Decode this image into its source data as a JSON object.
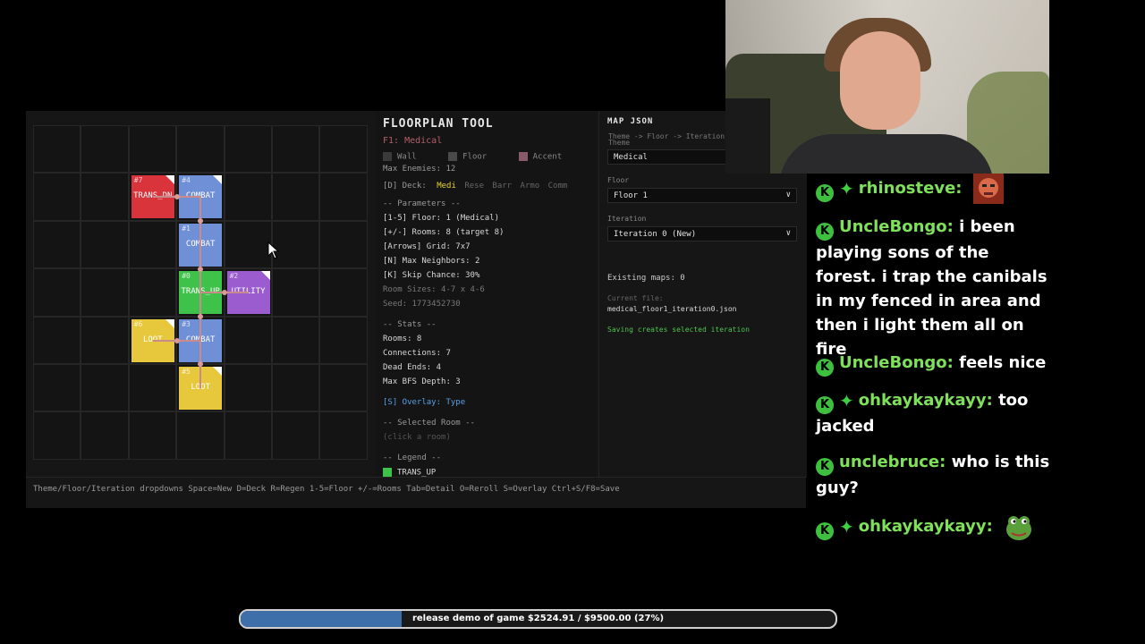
{
  "floorplan_tool": {
    "title": "FLOORPLAN TOOL",
    "subtitle": "F1: Medical",
    "legend_top": {
      "wall": "Wall",
      "floor": "Floor",
      "accent": "Accent"
    },
    "max_enemies": "Max Enemies: 12",
    "deck_label": "[D] Deck:",
    "deck_items": [
      "Medi",
      "Rese",
      "Barr",
      "Armo",
      "Comm"
    ],
    "params_header": "-- Parameters --",
    "params": [
      "[1-5] Floor: 1 (Medical)",
      "[+/-] Rooms: 8 (target 8)",
      "[Arrows] Grid: 7x7",
      "[N] Max Neighbors: 2",
      "[K] Skip Chance: 30%"
    ],
    "room_sizes": "Room Sizes: 4-7 x 4-6",
    "seed": "Seed: 1773452730",
    "stats_header": "-- Stats --",
    "stats": [
      "Rooms: 8",
      "Connections: 7",
      "Dead Ends: 4",
      "Max BFS Depth: 3"
    ],
    "overlay": "[S] Overlay: Type",
    "selected_header": "-- Selected Room --",
    "selected_hint": "(click a room)",
    "legend_header": "-- Legend --",
    "legend_first": "TRANS_UP"
  },
  "rooms": [
    {
      "num": "#7",
      "type": "TRANS_DN",
      "color": "#d9333c",
      "corner": true
    },
    {
      "num": "#4",
      "type": "COMBAT",
      "color": "#6f8fd6",
      "corner": true
    },
    {
      "num": "#1",
      "type": "COMBAT",
      "color": "#6f8fd6",
      "corner": false
    },
    {
      "num": "#0",
      "type": "TRANS_UP",
      "color": "#3fc24a",
      "corner": false
    },
    {
      "num": "#2",
      "type": "UTILITY",
      "color": "#9a5ccf",
      "corner": true
    },
    {
      "num": "#6",
      "type": "LOOT",
      "color": "#e7c73c",
      "corner": true
    },
    {
      "num": "#3",
      "type": "COMBAT",
      "color": "#6f8fd6",
      "corner": false
    },
    {
      "num": "#5",
      "type": "LOOT",
      "color": "#e7c73c",
      "corner": true
    }
  ],
  "map_json": {
    "title": "MAP JSON",
    "flow_hint": "Theme -> Floor -> Iteration",
    "theme_label": "Theme",
    "theme_value": "Medical",
    "floor_label": "Floor",
    "floor_value": "Floor 1",
    "iteration_label": "Iteration",
    "iteration_value": "Iteration 0 (New)",
    "existing_maps": "Existing maps: 0",
    "current_file_label": "Current file:",
    "current_file": "medical_floor1_iteration0.json",
    "saving_note": "Saving creates selected iteration"
  },
  "bottom_hint": "Theme/Floor/Iteration dropdowns  Space=New  D=Deck  R=Regen  1-5=Floor  +/-=Rooms  Tab=Detail  O=Reroll  S=Overlay  Ctrl+S/F8=Save",
  "chat": [
    {
      "user": "rhinosteve:",
      "text": "",
      "badges": 2,
      "emote": "face"
    },
    {
      "user": "UncleBongo:",
      "text": "i been playing sons of the forest. i trap the canibals in my fenced in area and then i light them all on fire",
      "badges": 1
    },
    {
      "user": "UncleBongo:",
      "text": "feels nice",
      "badges": 1
    },
    {
      "user": "ohkaykaykayy:",
      "text": "too jacked",
      "badges": 2
    },
    {
      "user": "unclebruce:",
      "text": "who is this guy?",
      "badges": 1
    },
    {
      "user": "ohkaykaykayy:",
      "text": "",
      "badges": 2,
      "emote": "frog"
    }
  ],
  "goal": {
    "label": "release demo of game $2524.91 / $9500.00 (27%)",
    "progress": 0.27,
    "color": "#3f6fa8"
  },
  "colors": {
    "wall": "#3a3a3a",
    "floor": "#4a4a4a",
    "accent": "#8a5a6a",
    "deck_active": "#e6d23a",
    "overlay": "#5aa0e6",
    "success": "#4fc24f"
  }
}
